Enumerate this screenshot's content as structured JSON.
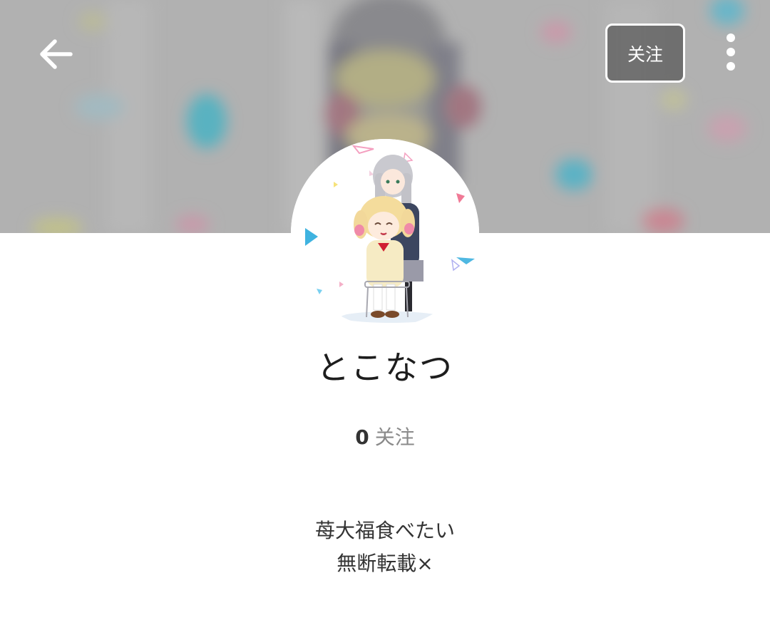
{
  "header": {
    "back_icon": "arrow-left-icon",
    "follow_label": "关注",
    "more_icon": "more-vertical-icon"
  },
  "profile": {
    "username": "とこなつ",
    "following_count": "0",
    "following_label": "关注",
    "bio_lines": [
      "苺大福食べたい",
      "無断転載×"
    ]
  },
  "colors": {
    "cover_bg": "#b9b9b9",
    "text_primary": "#1d1d1d",
    "text_secondary": "#8a8a8a"
  }
}
